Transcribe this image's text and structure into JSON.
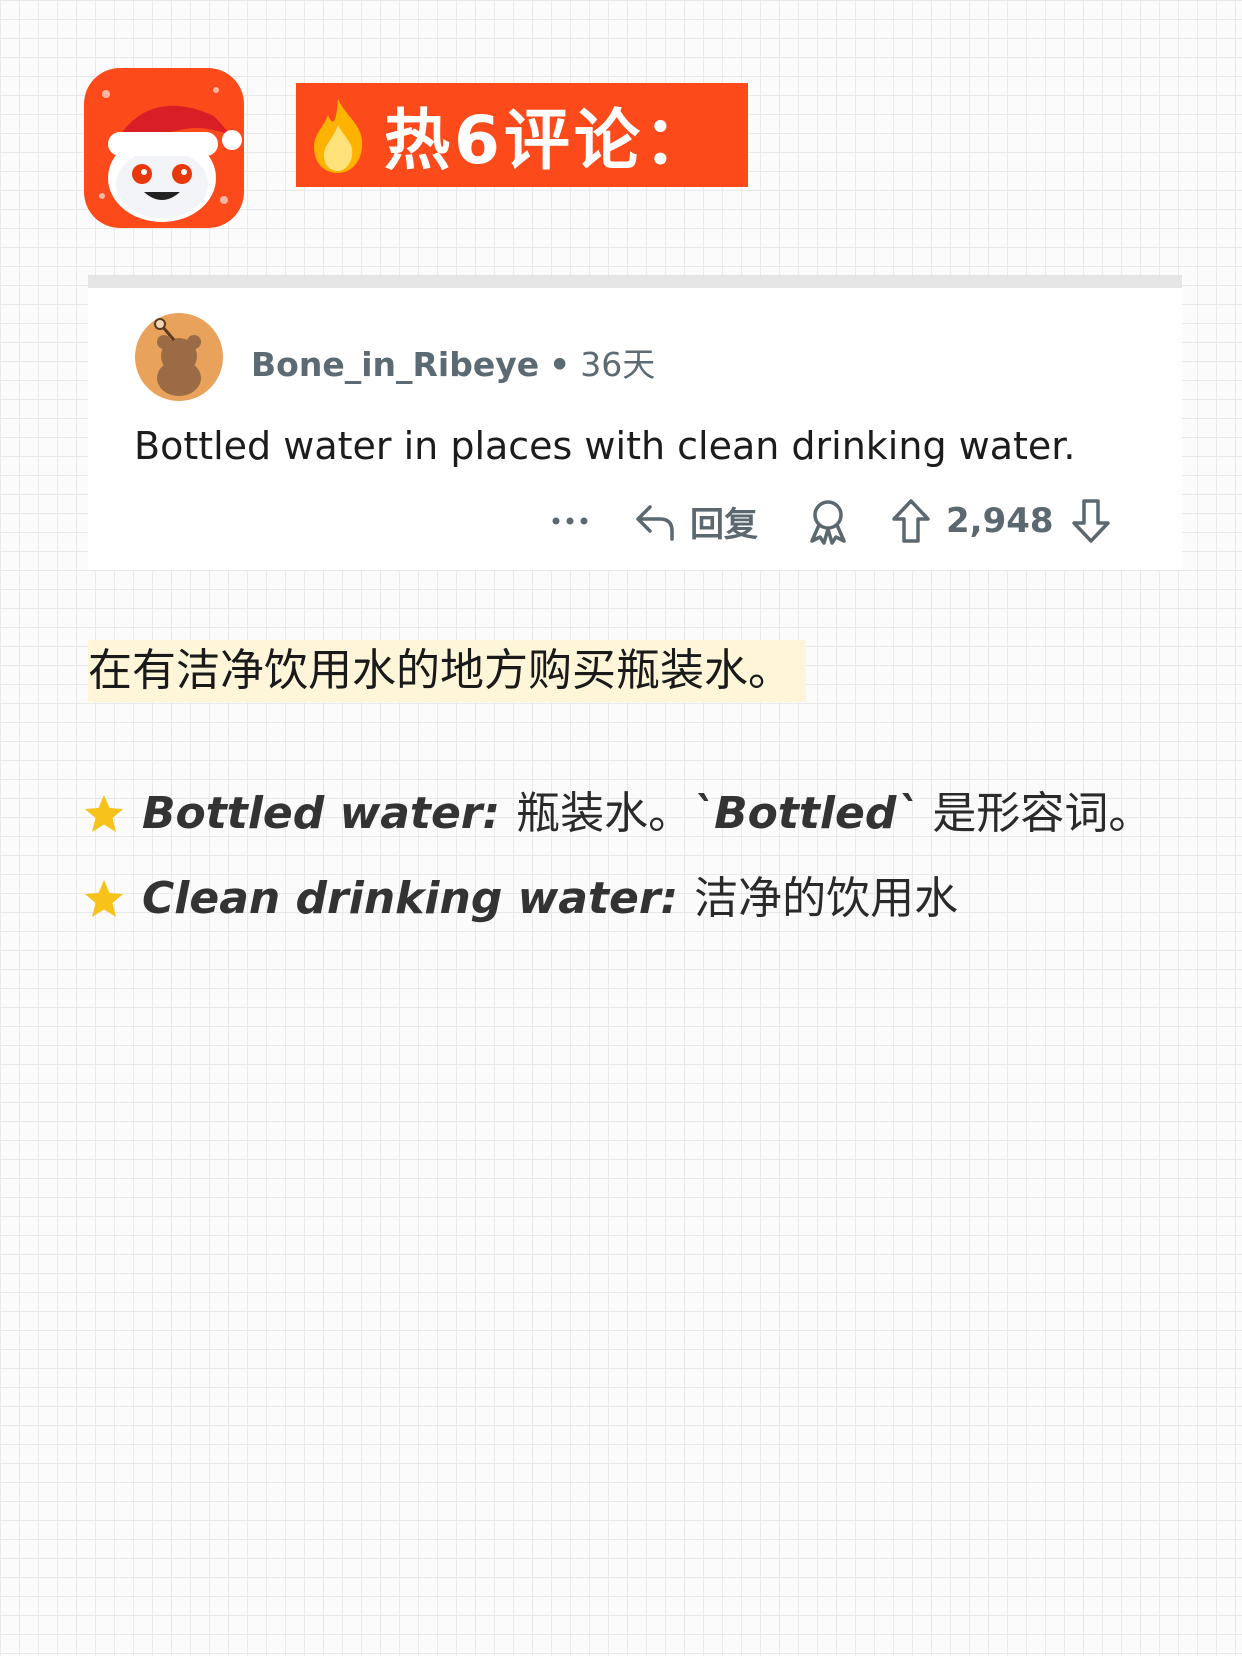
{
  "header": {
    "app_icon": "reddit-snoo-santa-icon",
    "flame_icon": "fire-emoji",
    "title": "热6评论："
  },
  "comment": {
    "avatar_icon": "snoo-avatar-icon",
    "username": "Bone_in_Ribeye",
    "separator": "•",
    "age": "36天",
    "body": "Bottled water in places with clean drinking water.",
    "actions": {
      "more_icon": "more-dots-icon",
      "reply_icon": "reply-arrow-icon",
      "reply_label": "回复",
      "award_icon": "award-icon",
      "upvote_icon": "upvote-arrow-icon",
      "score": "2,948",
      "downvote_icon": "downvote-arrow-icon"
    }
  },
  "translation": "在有洁净饮用水的地方购买瓶装水。",
  "vocabulary": [
    {
      "icon": "star-icon",
      "term": "Bottled water:",
      "definition_prefix": "瓶装水。",
      "code_term": "`Bottled`",
      "definition_suffix": " 是形容词。"
    },
    {
      "icon": "star-icon",
      "term": "Clean drinking water:",
      "definition": "洁净的饮用水"
    }
  ],
  "colors": {
    "brand_orange": "#fc4a1b",
    "highlight": "#fff6da",
    "meta_gray": "#5c6a73",
    "star_yellow": "#f7c21a"
  }
}
